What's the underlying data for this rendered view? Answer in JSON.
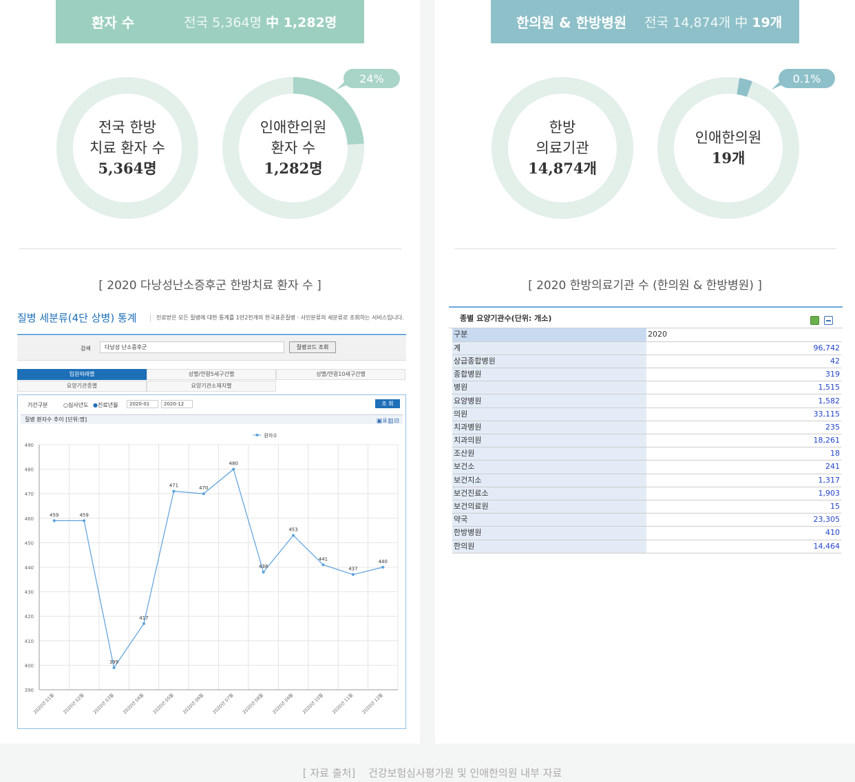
{
  "left": {
    "header_title": "환자 수",
    "header_prefix": "전국 5,364명",
    "header_bold": "中 1,282명",
    "donut1": {
      "line1": "전국 한방",
      "line2": "치료 환자 수",
      "value": "5,364명"
    },
    "donut2": {
      "line1": "인애한의원",
      "line2": "환자 수",
      "value": "1,282명",
      "percent_label": "24%",
      "fraction": 0.24
    },
    "caption": "[ 2020 다낭성난소증후군 한방치료 환자 수 ]"
  },
  "right": {
    "header_title": "한의원 & 한방병원",
    "header_prefix": "전국 14,874개 中",
    "header_bold": "19개",
    "donut1": {
      "line1": "한방",
      "line2": "의료기관",
      "value": "14,874개"
    },
    "donut2": {
      "line1": "인애한의원",
      "value": "19개",
      "percent_label": "0.1%",
      "fraction": 0.03
    },
    "caption": "[ 2020 한방의료기관 수 (한의원 & 한방병원) ]"
  },
  "colors": {
    "ring": "#e3efe9",
    "ring_fill": "#a9d4c8",
    "ring_fill_blue": "#8ec0c9",
    "line": "#5aa0dc",
    "link": "#1d6fb8"
  },
  "screenshot": {
    "title": "질병 세분류(4단 상병) 통계",
    "desc": "진료받은 모든 질병에 대한 통계를 1만2천개의 한국표준질병 · 사인분류의 세분류로 조회하는 서비스입니다.",
    "search_label": "검색",
    "search_value": "다낭성 난소증후군",
    "search_button": "질병코드 조회",
    "tabs": [
      "입원외래별",
      "성별/연령5세구간별",
      "성별/연령10세구간별",
      "요양기관종별",
      "요양기관소재지별"
    ],
    "period_label": "기간구분",
    "radio1": "심사년도",
    "radio2": "진료년월",
    "date_from": "2020-01",
    "date_to": "2020-12",
    "query_button": "조 회",
    "chart_header": "질병 환자수 추이 [단위:명]"
  },
  "chart_data": {
    "type": "line",
    "title": "질병 환자수 추이 [단위:명]",
    "categories": [
      "2020년 01월",
      "2020년 02월",
      "2020년 03월",
      "2020년 04월",
      "2020년 05월",
      "2020년 06월",
      "2020년 07월",
      "2020년 08월",
      "2020년 09월",
      "2020년 10월",
      "2020년 11월",
      "2020년 12월"
    ],
    "series": [
      {
        "name": "환자수",
        "values": [
          459,
          459,
          399,
          417,
          471,
          470,
          480,
          438,
          453,
          441,
          437,
          440
        ]
      }
    ],
    "ylim": [
      390,
      490
    ],
    "yticks": [
      390,
      400,
      410,
      420,
      430,
      440,
      450,
      460,
      470,
      480,
      490
    ],
    "grid": true,
    "legend": "top-center"
  },
  "table": {
    "title": "종별 요양기관수(단위: 개소)",
    "header": [
      "구분",
      "2020"
    ],
    "rows": [
      [
        "계",
        "96,742"
      ],
      [
        "상급종합병원",
        "42"
      ],
      [
        "종합병원",
        "319"
      ],
      [
        "병원",
        "1,515"
      ],
      [
        "요양병원",
        "1,582"
      ],
      [
        "의원",
        "33,115"
      ],
      [
        "치과병원",
        "235"
      ],
      [
        "치과의원",
        "18,261"
      ],
      [
        "조산원",
        "18"
      ],
      [
        "보건소",
        "241"
      ],
      [
        "보건지소",
        "1,317"
      ],
      [
        "보건진료소",
        "1,903"
      ],
      [
        "보건의료원",
        "15"
      ],
      [
        "약국",
        "23,305"
      ],
      [
        "한방병원",
        "410"
      ],
      [
        "한의원",
        "14,464"
      ]
    ]
  },
  "footer": {
    "label": "[ 자료 출처]",
    "text": "건강보험심사평가원 및 인애한의원 내부 자료"
  }
}
